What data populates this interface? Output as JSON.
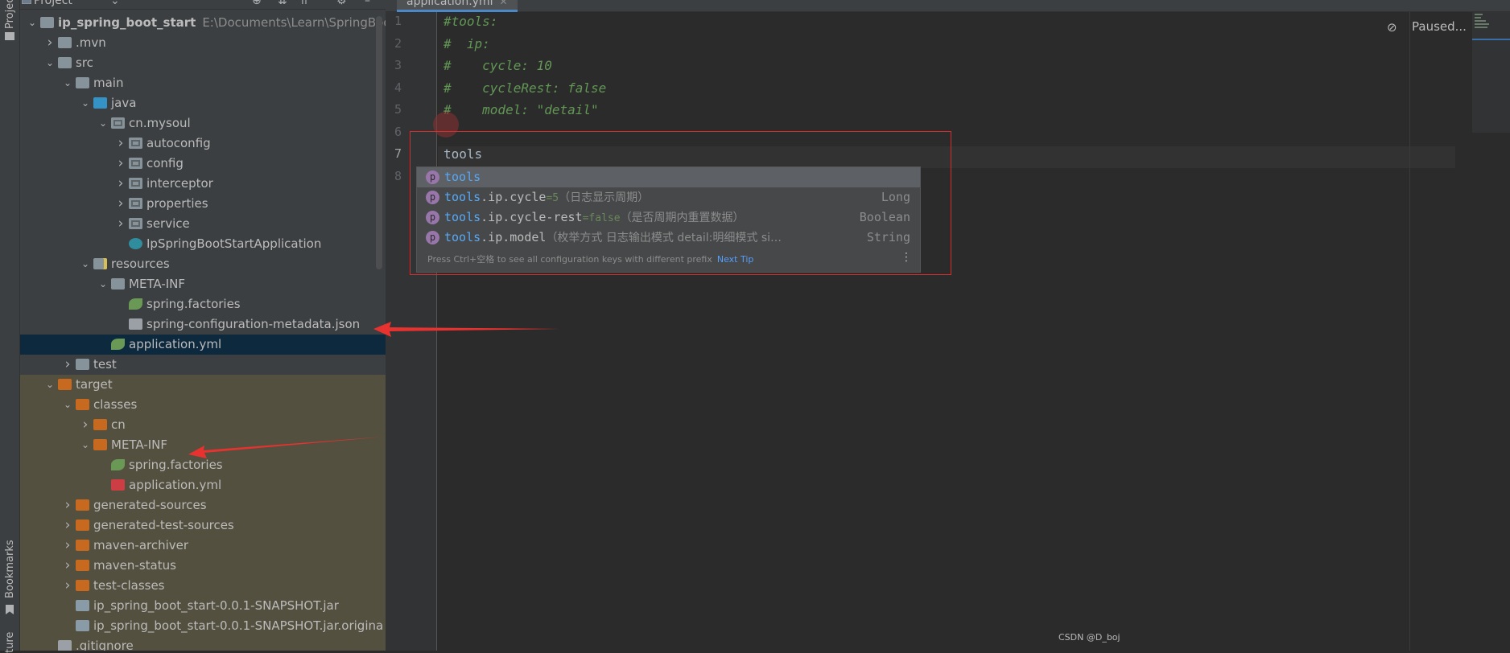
{
  "stripe": {
    "project_tab": "Project",
    "bookmarks_tab": "Bookmarks",
    "structure_tab": "ture"
  },
  "project_panel": {
    "title": "Project",
    "tree": [
      {
        "label": "ip_spring_boot_start",
        "path": "E:\\Documents\\Learn\\SpringBoot\\",
        "type": "module",
        "expanded": true,
        "bold": true
      },
      {
        "label": ".mvn",
        "type": "folder",
        "expanded": false
      },
      {
        "label": "src",
        "type": "folder",
        "expanded": true
      },
      {
        "label": "main",
        "type": "folder",
        "expanded": true
      },
      {
        "label": "java",
        "type": "source-folder",
        "expanded": true
      },
      {
        "label": "cn.mysoul",
        "type": "package",
        "expanded": true
      },
      {
        "label": "autoconfig",
        "type": "package",
        "expanded": false
      },
      {
        "label": "config",
        "type": "package",
        "expanded": false
      },
      {
        "label": "interceptor",
        "type": "package",
        "expanded": false
      },
      {
        "label": "properties",
        "type": "package",
        "expanded": false
      },
      {
        "label": "service",
        "type": "package",
        "expanded": false
      },
      {
        "label": "IpSpringBootStartApplication",
        "type": "spring-class"
      },
      {
        "label": "resources",
        "type": "resources-folder",
        "expanded": true
      },
      {
        "label": "META-INF",
        "type": "folder",
        "expanded": true
      },
      {
        "label": "spring.factories",
        "type": "spring-file"
      },
      {
        "label": "spring-configuration-metadata.json",
        "type": "json-file"
      },
      {
        "label": "application.yml",
        "type": "spring-yml",
        "selected": true
      },
      {
        "label": "test",
        "type": "folder",
        "expanded": false
      },
      {
        "label": "target",
        "type": "excluded-folder",
        "expanded": true
      },
      {
        "label": "classes",
        "type": "excluded-folder",
        "expanded": true
      },
      {
        "label": "cn",
        "type": "excluded-folder",
        "expanded": false
      },
      {
        "label": "META-INF",
        "type": "excluded-folder",
        "expanded": true
      },
      {
        "label": "spring.factories",
        "type": "spring-file"
      },
      {
        "label": "application.yml",
        "type": "yml-file"
      },
      {
        "label": "generated-sources",
        "type": "excluded-folder",
        "expanded": false
      },
      {
        "label": "generated-test-sources",
        "type": "excluded-folder",
        "expanded": false
      },
      {
        "label": "maven-archiver",
        "type": "excluded-folder",
        "expanded": false
      },
      {
        "label": "maven-status",
        "type": "excluded-folder",
        "expanded": false
      },
      {
        "label": "test-classes",
        "type": "excluded-folder",
        "expanded": false
      },
      {
        "label": "ip_spring_boot_start-0.0.1-SNAPSHOT.jar",
        "type": "jar"
      },
      {
        "label": "ip_spring_boot_start-0.0.1-SNAPSHOT.jar.origina",
        "type": "jar"
      },
      {
        "label": ".gitignore",
        "type": "file"
      }
    ]
  },
  "editor": {
    "tab_label": "application.yml",
    "status": "Paused...",
    "line_numbers": [
      "1",
      "2",
      "3",
      "4",
      "5",
      "6",
      "7",
      "8"
    ],
    "current_line": "7",
    "lines": [
      {
        "text": "#tools:",
        "kind": "comment"
      },
      {
        "text": "#  ip:",
        "kind": "comment"
      },
      {
        "text": "#    cycle: 10",
        "kind": "comment"
      },
      {
        "text": "#    cycleRest: false",
        "kind": "comment"
      },
      {
        "text": "#    model: \"detail\"",
        "kind": "comment"
      },
      {
        "text": "",
        "kind": "plain"
      },
      {
        "text": "tools",
        "kind": "plain"
      },
      {
        "text": "",
        "kind": "plain"
      }
    ]
  },
  "completion": {
    "items": [
      {
        "icon": "p",
        "match": "tools",
        "rest": "",
        "default": "",
        "desc": "",
        "type": "",
        "selected": true
      },
      {
        "icon": "p",
        "match": "tools",
        "rest": ".ip.cycle",
        "default": "=5",
        "desc": "（日志显示周期）",
        "type": "Long"
      },
      {
        "icon": "p",
        "match": "tools",
        "rest": ".ip.cycle-rest",
        "default": "=false",
        "desc": "（是否周期内重置数据）",
        "type": "Boolean"
      },
      {
        "icon": "p",
        "match": "tools",
        "rest": ".ip.model",
        "default": "",
        "desc": "（枚举方式 日志输出模式 detail:明细模式 si…",
        "type": "String"
      }
    ],
    "hint": "Press Ctrl+空格 to see all configuration keys with different prefix",
    "next_tip": "Next Tip"
  },
  "watermark": "CSDN @D_boj",
  "colors": {
    "annotation_red": "#d62c2c",
    "selection_blue": "#0d293e",
    "excluded_bg": "#54503f"
  }
}
